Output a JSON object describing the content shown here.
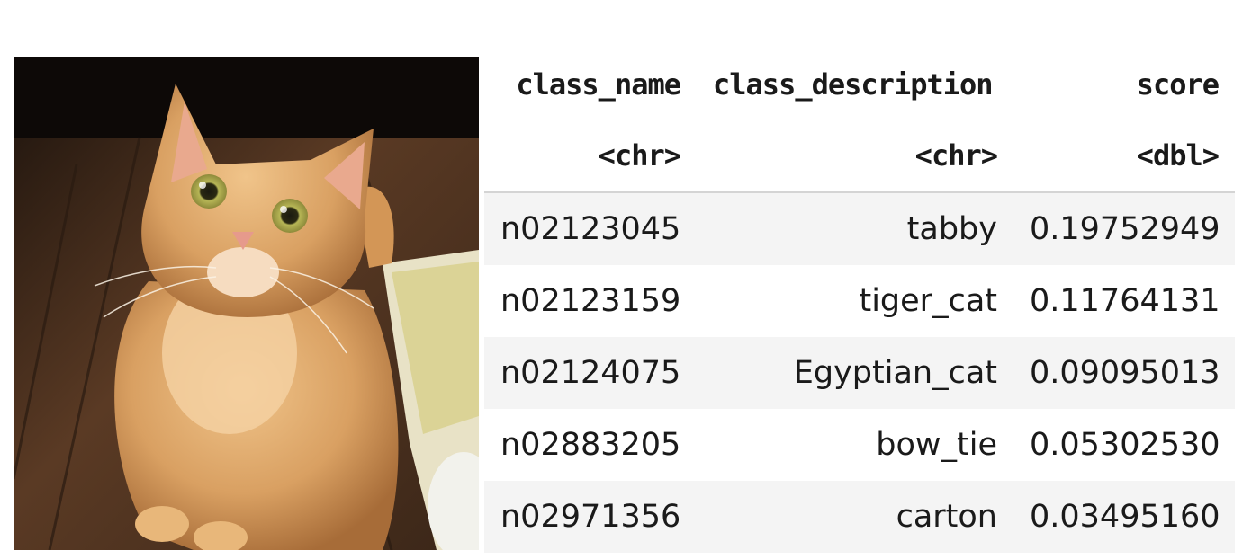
{
  "image": {
    "subject": "cat-photo"
  },
  "table": {
    "columns": [
      {
        "name": "class_name",
        "type": "<chr>"
      },
      {
        "name": "class_description",
        "type": "<chr>"
      },
      {
        "name": "score",
        "type": "<dbl>"
      }
    ],
    "rows": [
      {
        "class_name": "n02123045",
        "class_description": "tabby",
        "score": "0.19752949"
      },
      {
        "class_name": "n02123159",
        "class_description": "tiger_cat",
        "score": "0.11764131"
      },
      {
        "class_name": "n02124075",
        "class_description": "Egyptian_cat",
        "score": "0.09095013"
      },
      {
        "class_name": "n02883205",
        "class_description": "bow_tie",
        "score": "0.05302530"
      },
      {
        "class_name": "n02971356",
        "class_description": "carton",
        "score": "0.03495160"
      }
    ]
  }
}
